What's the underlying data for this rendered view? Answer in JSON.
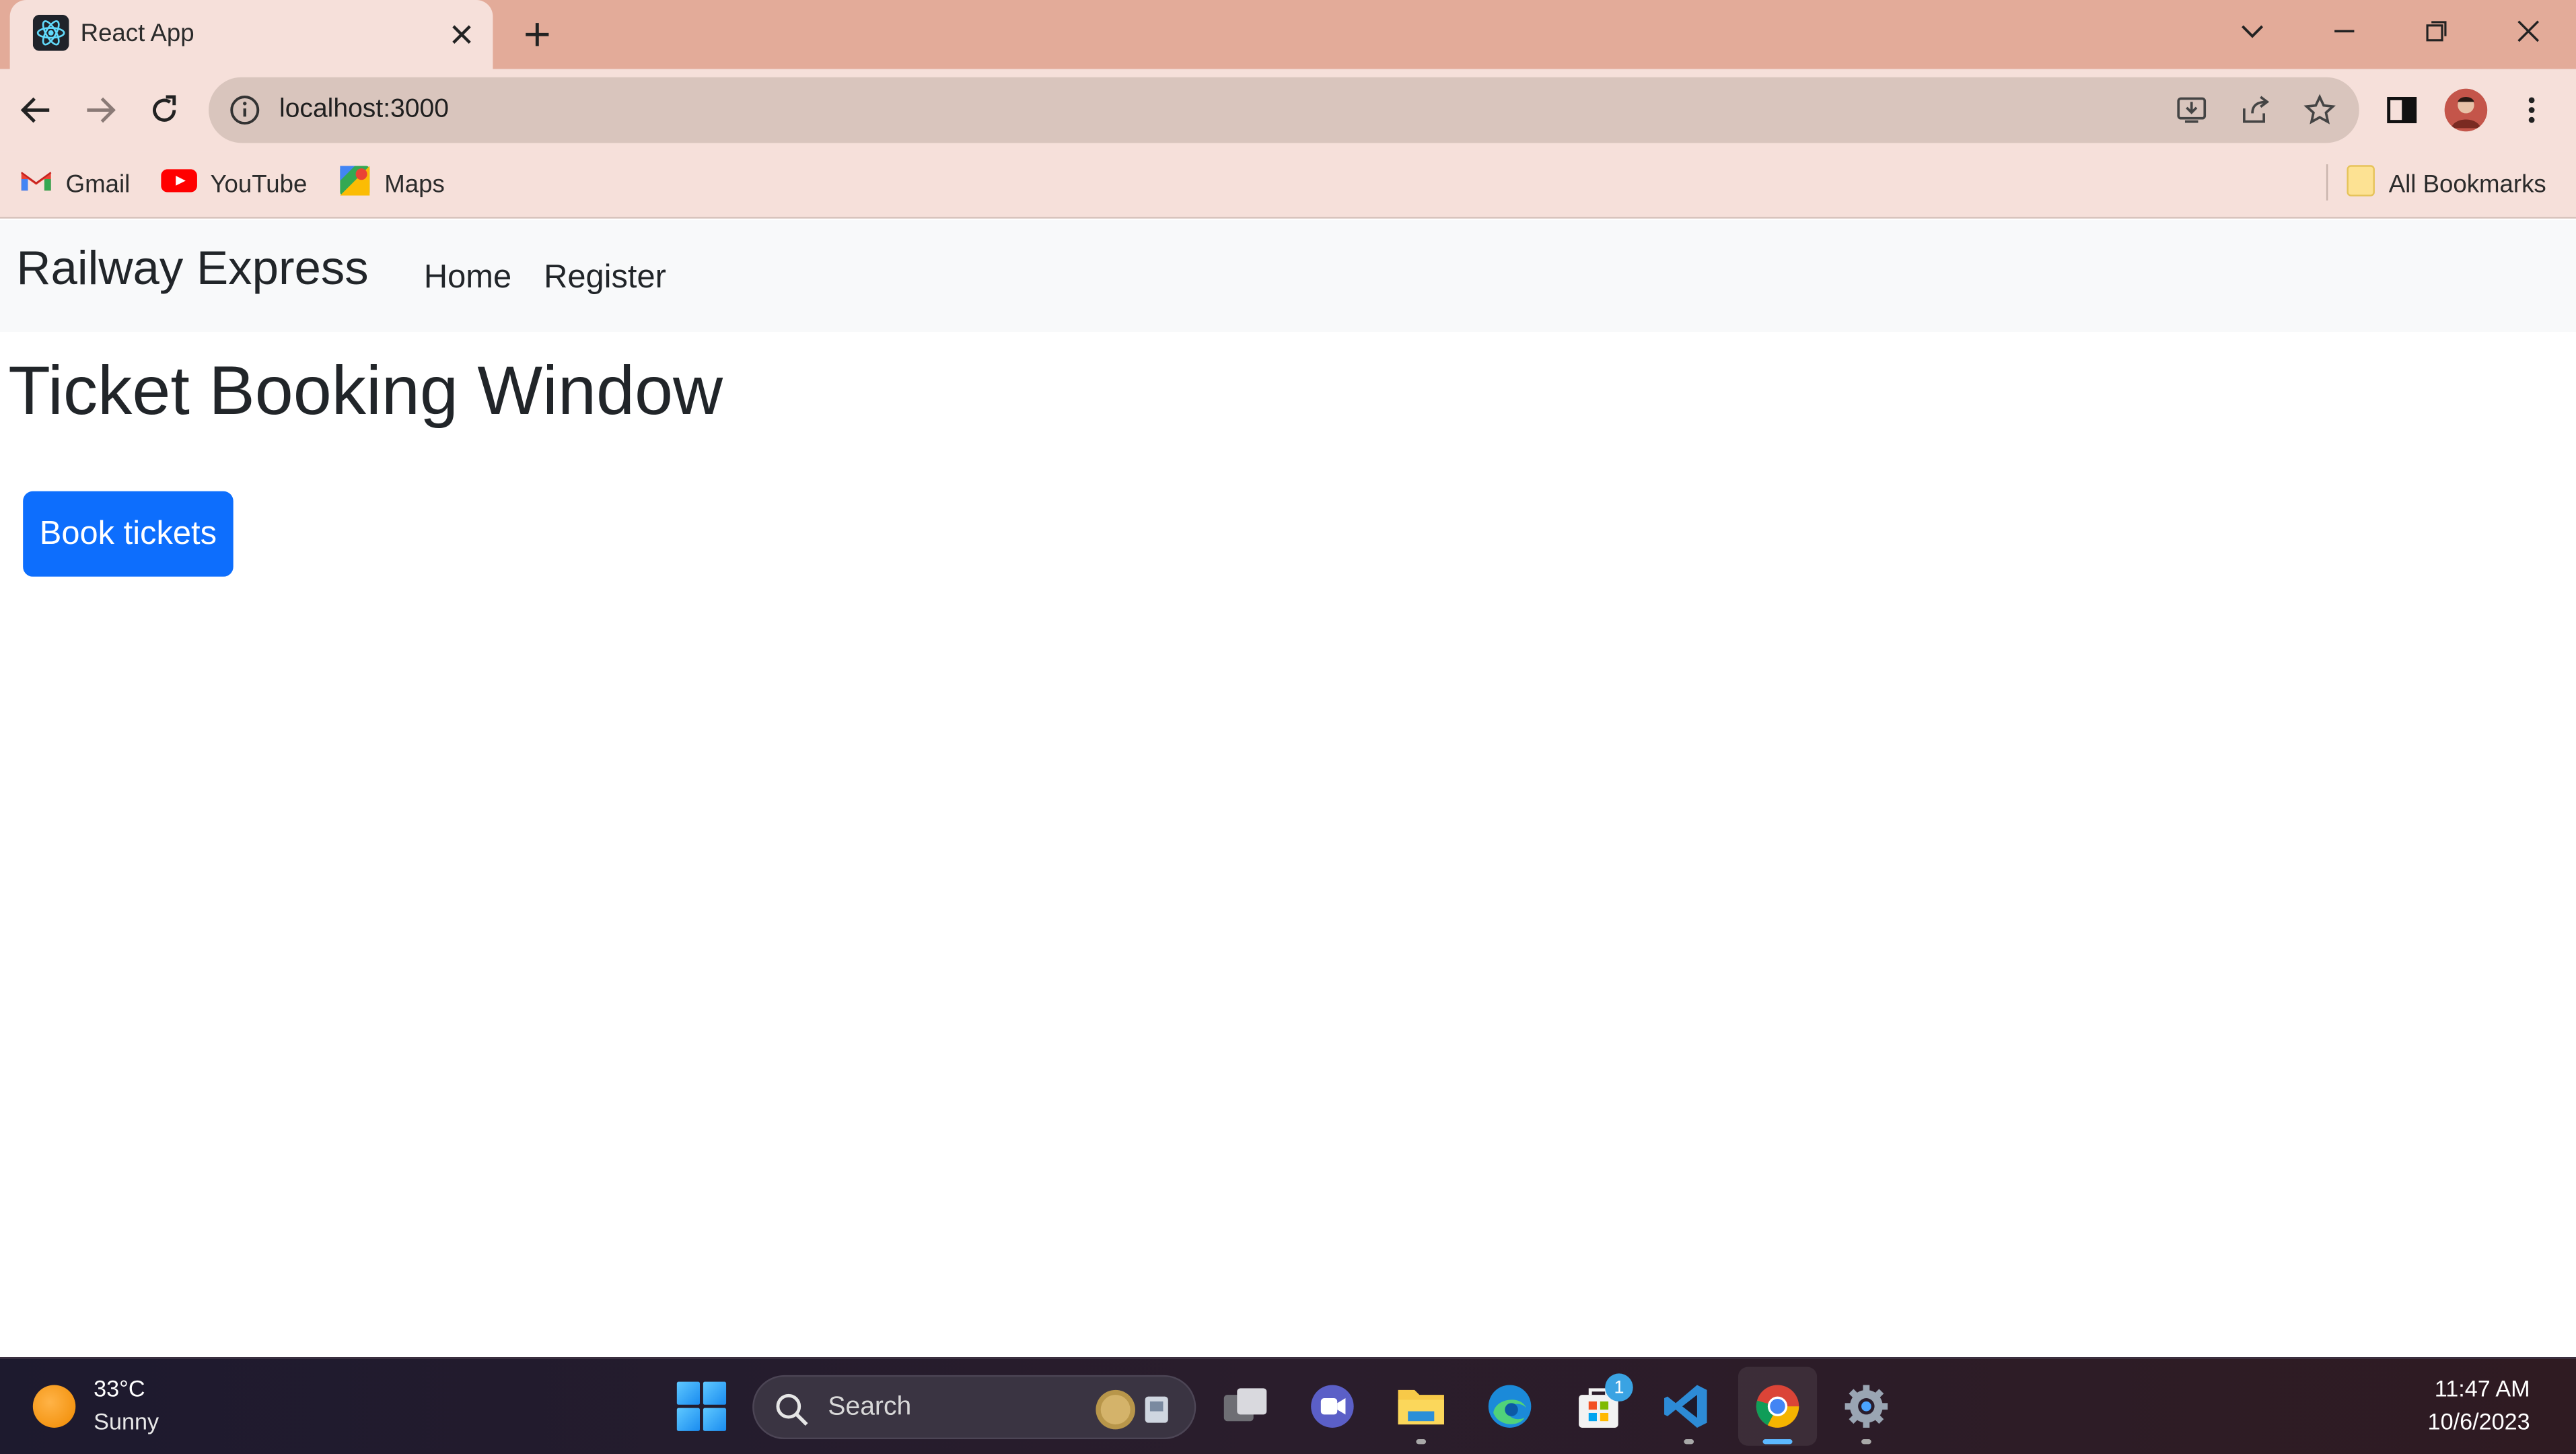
{
  "browser": {
    "tab": {
      "title": "React App",
      "favicon": "react-logo-icon"
    },
    "address": {
      "url": "localhost:3000"
    },
    "bookmarks": [
      {
        "label": "Gmail",
        "icon": "gmail-icon"
      },
      {
        "label": "YouTube",
        "icon": "youtube-icon"
      },
      {
        "label": "Maps",
        "icon": "maps-icon"
      }
    ],
    "all_bookmarks_label": "All Bookmarks"
  },
  "app": {
    "brand": "Railway Express",
    "nav": [
      {
        "label": "Home"
      },
      {
        "label": "Register"
      }
    ],
    "heading": "Ticket Booking Window",
    "book_button": "Book tickets"
  },
  "taskbar": {
    "weather": {
      "temp": "33°C",
      "desc": "Sunny"
    },
    "search_placeholder": "Search",
    "store_badge": "1",
    "clock": {
      "time": "11:47 AM",
      "date": "10/6/2023"
    }
  },
  "colors": {
    "tab_strip": "#e3ab99",
    "toolbar": "#f6e0da",
    "primary_button": "#0d6efd",
    "navbar": "#f8f9fa"
  }
}
